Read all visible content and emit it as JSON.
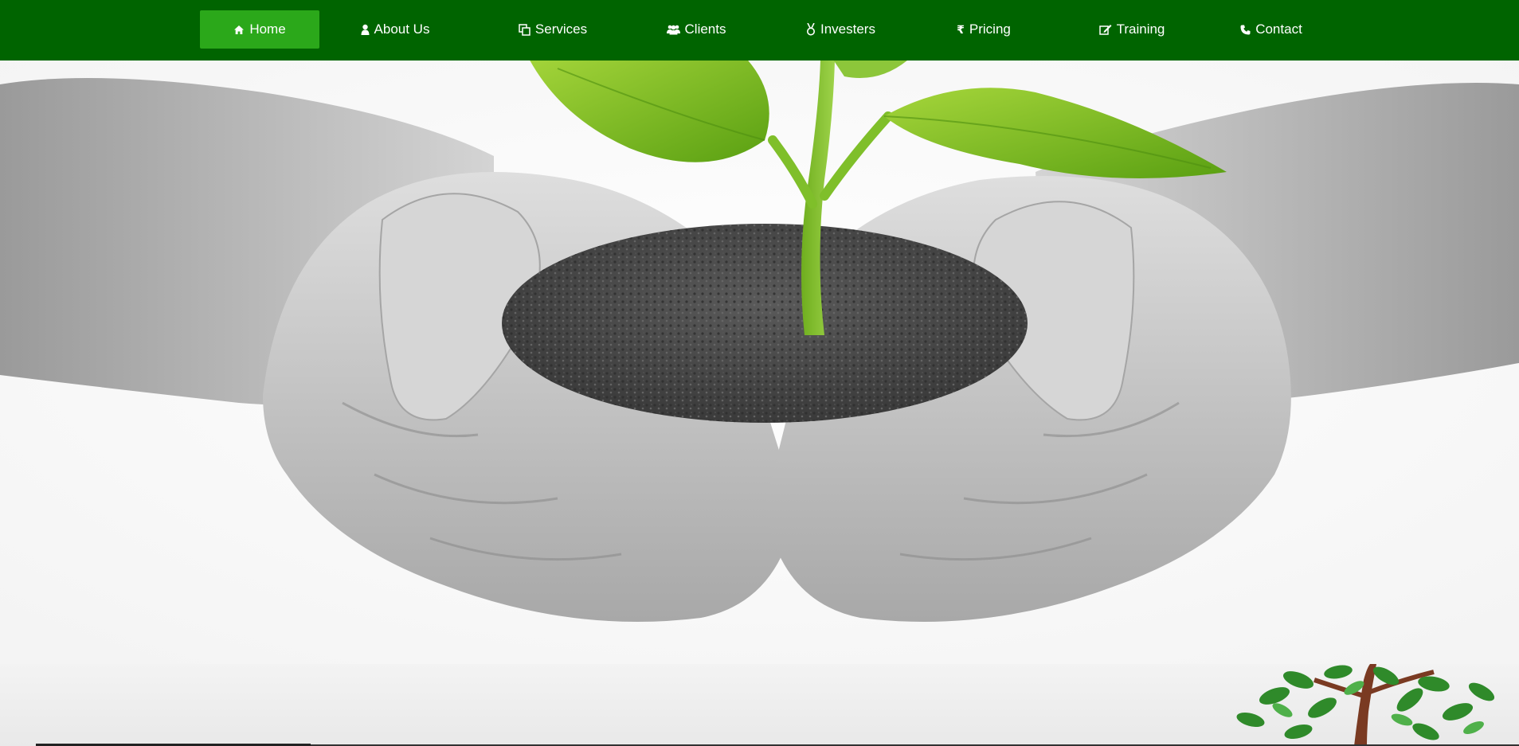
{
  "nav": {
    "items": [
      {
        "label": "Home",
        "icon": "home-icon",
        "active": true
      },
      {
        "label": "About Us",
        "icon": "user-icon",
        "active": false
      },
      {
        "label": "Services",
        "icon": "copy-icon",
        "active": false
      },
      {
        "label": "Clients",
        "icon": "users-icon",
        "active": false
      },
      {
        "label": "Investers",
        "icon": "medal-icon",
        "active": false
      },
      {
        "label": "Pricing",
        "icon": "rupee-icon",
        "active": false
      },
      {
        "label": "Training",
        "icon": "edit-icon",
        "active": false
      },
      {
        "label": "Contact",
        "icon": "phone-icon",
        "active": false
      }
    ]
  },
  "hero": {
    "image": "hands-holding-plant-seedling-in-soil",
    "secondary_image": "small-tree-illustration"
  },
  "colors": {
    "nav_background": "#006400",
    "nav_active": "#2ba81a",
    "nav_text": "#ffffff",
    "leaf": "#7cc21e",
    "soil": "#4a4a4a",
    "hands": "#c9c9c9"
  }
}
